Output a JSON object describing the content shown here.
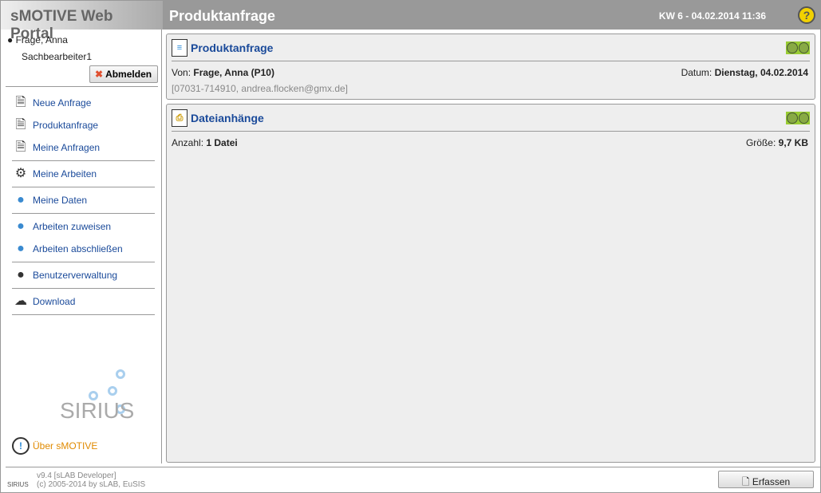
{
  "app_title": "sMOTIVE Web Portal",
  "header": {
    "title": "Produktanfrage",
    "week_date": "KW 6 - 04.02.2014 11:36",
    "help": "?"
  },
  "user": {
    "name": "Frage, Anna",
    "role": "Sachbearbeiter1",
    "logout_label": "Abmelden"
  },
  "menu": [
    {
      "label": "Neue Anfrage",
      "icon": "new-document-icon"
    },
    {
      "label": "Produktanfrage",
      "icon": "list-document-icon"
    },
    {
      "label": "Meine Anfragen",
      "icon": "document-gear-icon"
    },
    {
      "label": "Meine Arbeiten",
      "icon": "gears-icon"
    },
    {
      "label": "Meine Daten",
      "icon": "person-icon"
    },
    {
      "label": "Arbeiten zuweisen",
      "icon": "worker-icon"
    },
    {
      "label": "Arbeiten abschließen",
      "icon": "worker-done-icon"
    },
    {
      "label": "Benutzerverwaltung",
      "icon": "users-icon"
    },
    {
      "label": "Download",
      "icon": "cloud-download-icon"
    }
  ],
  "logo_text": "SIRIUS",
  "about_label": "Über sMOTIVE",
  "panel1": {
    "title": "Produktanfrage",
    "from_label": "Von:",
    "from_value": "Frage, Anna (P10)",
    "date_label": "Datum:",
    "date_value": "Dienstag, 04.02.2014",
    "contact": "[07031-714910, andrea.flocken@gmx.de]"
  },
  "panel2": {
    "title": "Dateianhänge",
    "count_label": "Anzahl:",
    "count_value": "1 Datei",
    "size_label": "Größe:",
    "size_value": "9,7 KB"
  },
  "footer": {
    "version": "v9.4 [sLAB Developer]",
    "copyright": "(c) 2005-2014 by sLAB, EuSIS",
    "button": "Erfassen"
  }
}
